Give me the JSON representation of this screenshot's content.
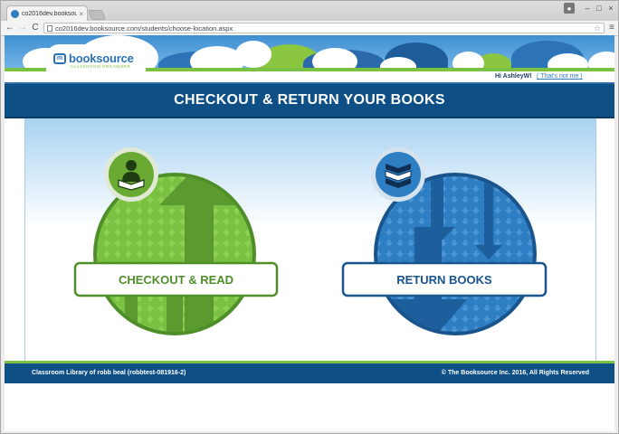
{
  "browser": {
    "tab_title": "co2016dev.booksource.co",
    "tab_close": "×",
    "url": "co2016dev.booksource.com/students/choose-location.aspx",
    "back": "←",
    "forward": "→",
    "reload": "C",
    "star": "☆",
    "menu": "≡",
    "window_min": "–",
    "window_max": "□",
    "window_close": "×"
  },
  "logo": {
    "name": "booksource",
    "tagline": "CLASSROOM ORGANIZER"
  },
  "header": {
    "greeting": "Hi AshleyW!",
    "not_me": "( That's not me )"
  },
  "page": {
    "title": "CHECKOUT & RETURN YOUR BOOKS"
  },
  "options": [
    {
      "label": "CHECKOUT & READ",
      "icon": "reader-icon",
      "color": "#7ac143",
      "dark": "#5a9a2e",
      "ring": "#4f8f2a"
    },
    {
      "label": "RETURN BOOKS",
      "icon": "books-stack-icon",
      "color": "#2e7ec4",
      "dark": "#1d5f9c",
      "ring": "#1a548c"
    }
  ],
  "footer": {
    "library": "Classroom Library of robb beal (robbtest-081916-2)",
    "copyright": "© The Booksource Inc. 2016, All Rights Reserved"
  },
  "colors": {
    "brand_blue": "#0e4f86",
    "brand_green": "#7ac143",
    "link_blue": "#2c7cc4"
  }
}
